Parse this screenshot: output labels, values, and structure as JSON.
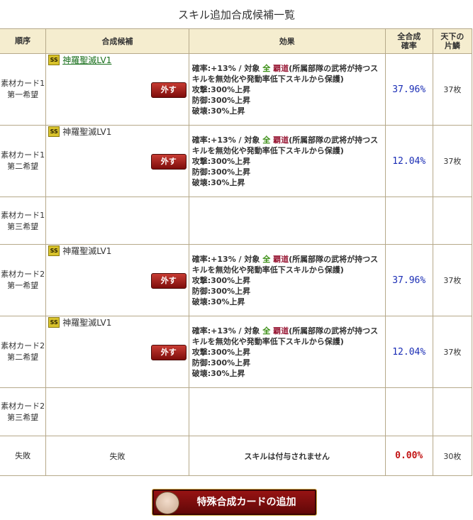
{
  "page_title": "スキル追加合成候補一覧",
  "headers": {
    "order": "順序",
    "candidate": "合成候補",
    "effect": "効果",
    "total_rate": "全合成確率",
    "tenka": "天下の片鱗"
  },
  "grade_badge": "SS",
  "remove_label": "外す",
  "effect_template": {
    "line1_prefix": "確率:+13% / 対象 ",
    "target_all": "全",
    "target_hado": "覇道",
    "line1_suffix": "(所属部隊の武将が持つスキルを無効化や発動率低下スキルから保護)",
    "atk": "攻撃:300%上昇",
    "def": "防御:300%上昇",
    "brk": "破壊:30%上昇"
  },
  "rows": [
    {
      "order_a": "素材カード1",
      "order_b": "第一希望",
      "skill": "神羅聖滅LV1",
      "rate": "37.96%",
      "tenka": "37枚"
    },
    {
      "order_a": "素材カード1",
      "order_b": "第二希望",
      "skill": "神羅聖滅LV1",
      "rate": "12.04%",
      "tenka": "37枚"
    },
    {
      "order_a": "素材カード1",
      "order_b": "第三希望"
    },
    {
      "order_a": "素材カード2",
      "order_b": "第一希望",
      "skill": "神羅聖滅LV1",
      "rate": "37.96%",
      "tenka": "37枚"
    },
    {
      "order_a": "素材カード2",
      "order_b": "第二希望",
      "skill": "神羅聖滅LV1",
      "rate": "12.04%",
      "tenka": "37枚"
    },
    {
      "order_a": "素材カード2",
      "order_b": "第三希望"
    }
  ],
  "failure": {
    "order": "失敗",
    "candidate": "失敗",
    "effect": "スキルは付与されません",
    "rate": "0.00%",
    "tenka": "30枚"
  },
  "add_card_button": "特殊合成カードの追加",
  "colors": {
    "header_bg": "#f5edcf",
    "border": "#b6a98a",
    "rate_blue": "#1a2db5",
    "rate_red": "#c21414",
    "badge_gold": "#d8c22b",
    "button_red": "#8b1010"
  }
}
